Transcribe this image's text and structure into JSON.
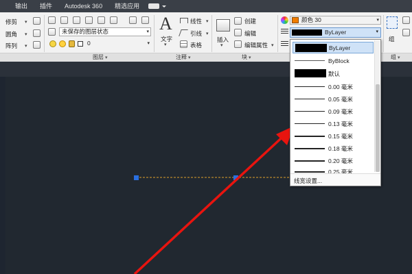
{
  "menu": {
    "items": [
      "输出",
      "插件",
      "Autodesk 360",
      "精选应用"
    ]
  },
  "ribbon": {
    "modify": {
      "items": [
        "修剪",
        "圆角",
        "阵列"
      ]
    },
    "layer": {
      "state_combo": "未保存的图层状态",
      "layer_combo": "0",
      "panel_label": "图层"
    },
    "annotation": {
      "text_label": "文字",
      "linear": "线性",
      "leader": "引线",
      "table": "表格",
      "panel_label": "注释"
    },
    "block": {
      "insert": "插入",
      "create": "创建",
      "edit": "编辑",
      "edit_attr": "编辑属性",
      "panel_label": "块"
    },
    "properties": {
      "color_value": "颜色 30",
      "lineweight_value": "ByLayer"
    },
    "group": {
      "label": "组",
      "panel_label": "组"
    }
  },
  "lineweight_dropdown": {
    "options": [
      {
        "label": "ByLayer",
        "kind": "swatch",
        "selected": true
      },
      {
        "label": "ByBlock",
        "kind": "thin"
      },
      {
        "label": "默认",
        "kind": "swatch"
      },
      {
        "label": "0.00 毫米",
        "kind": "line"
      },
      {
        "label": "0.05 毫米",
        "kind": "line"
      },
      {
        "label": "0.09 毫米",
        "kind": "line"
      },
      {
        "label": "0.13 毫米",
        "kind": "line"
      },
      {
        "label": "0.15 毫米",
        "kind": "line"
      },
      {
        "label": "0.18 毫米",
        "kind": "line"
      },
      {
        "label": "0.20 毫米",
        "kind": "line"
      },
      {
        "label": "0.25 毫米",
        "kind": "line"
      }
    ],
    "footer": "线宽设置..."
  },
  "colors": {
    "canvas": "#212830",
    "accent": "#cfe2f7",
    "arrow": "#e8140f",
    "grip": "#2a6fe0",
    "dashed_line": "#e0a02a",
    "color_swatch": "#f07d00"
  }
}
